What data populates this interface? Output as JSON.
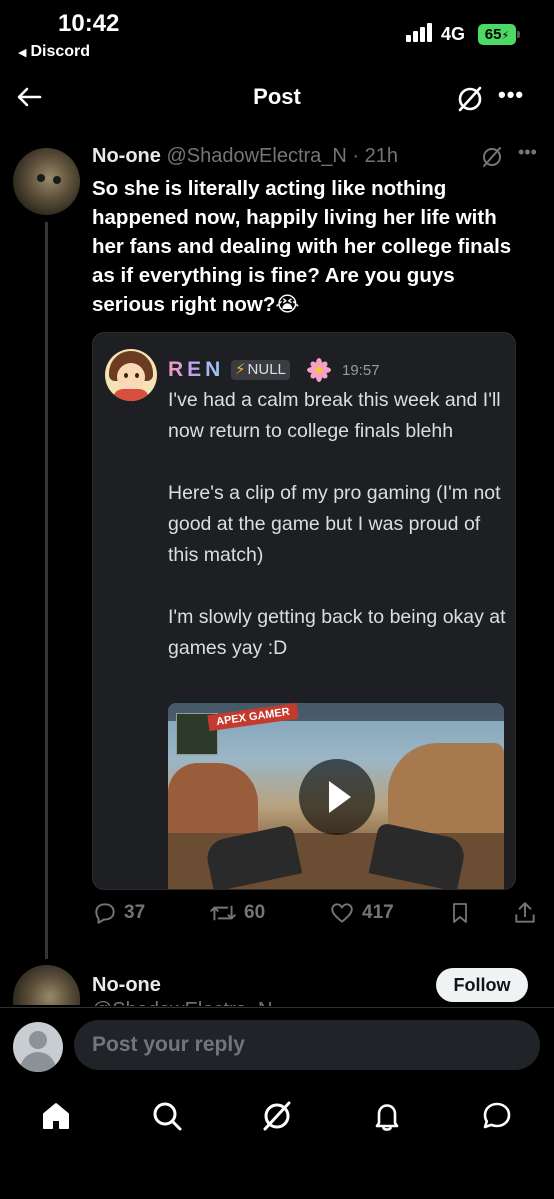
{
  "status_bar": {
    "time": "10:42",
    "back_app": "Discord",
    "network": "4G",
    "battery": "65"
  },
  "header": {
    "title": "Post"
  },
  "tweet": {
    "name": "No-one",
    "handle_time": "@ShadowElectra_N · 21h",
    "text": "So she is literally acting like nothing happened now, happily living her life with her fans and dealing with her college finals as if everything is fine? Are you guys serious right now?😭",
    "embed": {
      "username": "REN",
      "tag": "NULL",
      "time": "19:57",
      "paragraphs": [
        "I've had a calm break this week and I'll now return to college finals blehh",
        "Here's a clip of my pro gaming (I'm not good at the game but I was proud of this match)",
        "I'm slowly getting back to being okay at games yay :D"
      ],
      "video_logo": "APEX GAMER"
    },
    "stats": {
      "replies": "37",
      "reposts": "60",
      "likes": "417"
    }
  },
  "next_tweet": {
    "name": "No-one",
    "handle": "@ShadowElectra_N",
    "follow_label": "Follow"
  },
  "reply": {
    "placeholder": "Post your reply"
  },
  "colors": {
    "background": "#000000",
    "muted": "#71767b",
    "embed_bg": "#1e1f22",
    "battery": "#4cd964"
  }
}
